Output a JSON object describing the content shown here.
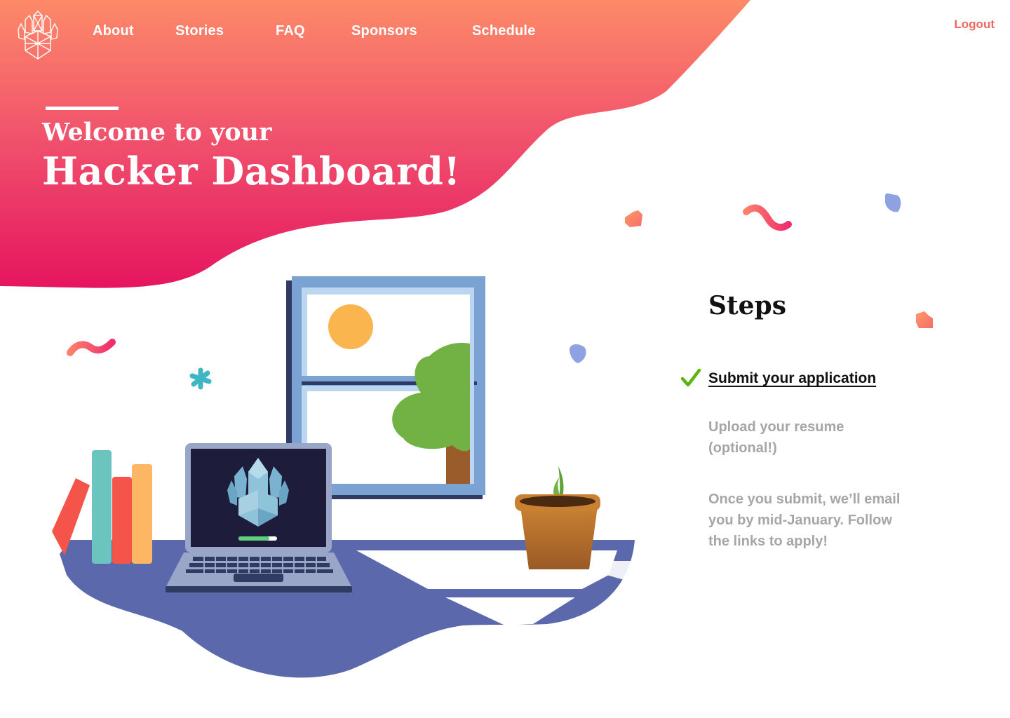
{
  "nav": {
    "links": [
      "About",
      "Stories",
      "FAQ",
      "Sponsors",
      "Schedule"
    ],
    "logout_label": "Logout"
  },
  "hero": {
    "subtitle": "Welcome to your",
    "title": "Hacker Dashboard!"
  },
  "steps": {
    "title": "Steps",
    "items": [
      {
        "label": "Submit your application",
        "completed": true
      },
      {
        "label": "Upload your resume (optional!)",
        "completed": false
      },
      {
        "label": "Once you submit, we’ll email you by mid-January. Follow the links to apply!",
        "completed": false
      }
    ]
  },
  "icons": {
    "logo": "crystal-hand-logo",
    "check": "checkmark-icon",
    "laptop_screen": "crystal-hand-logo"
  },
  "colors": {
    "header_gradient_top": "#fd8a68",
    "header_gradient_bottom": "#e5155f",
    "desk": "#5b68ac",
    "check_green": "#5db40f",
    "logout": "#f0675f",
    "muted_text": "#a6a6a6"
  }
}
